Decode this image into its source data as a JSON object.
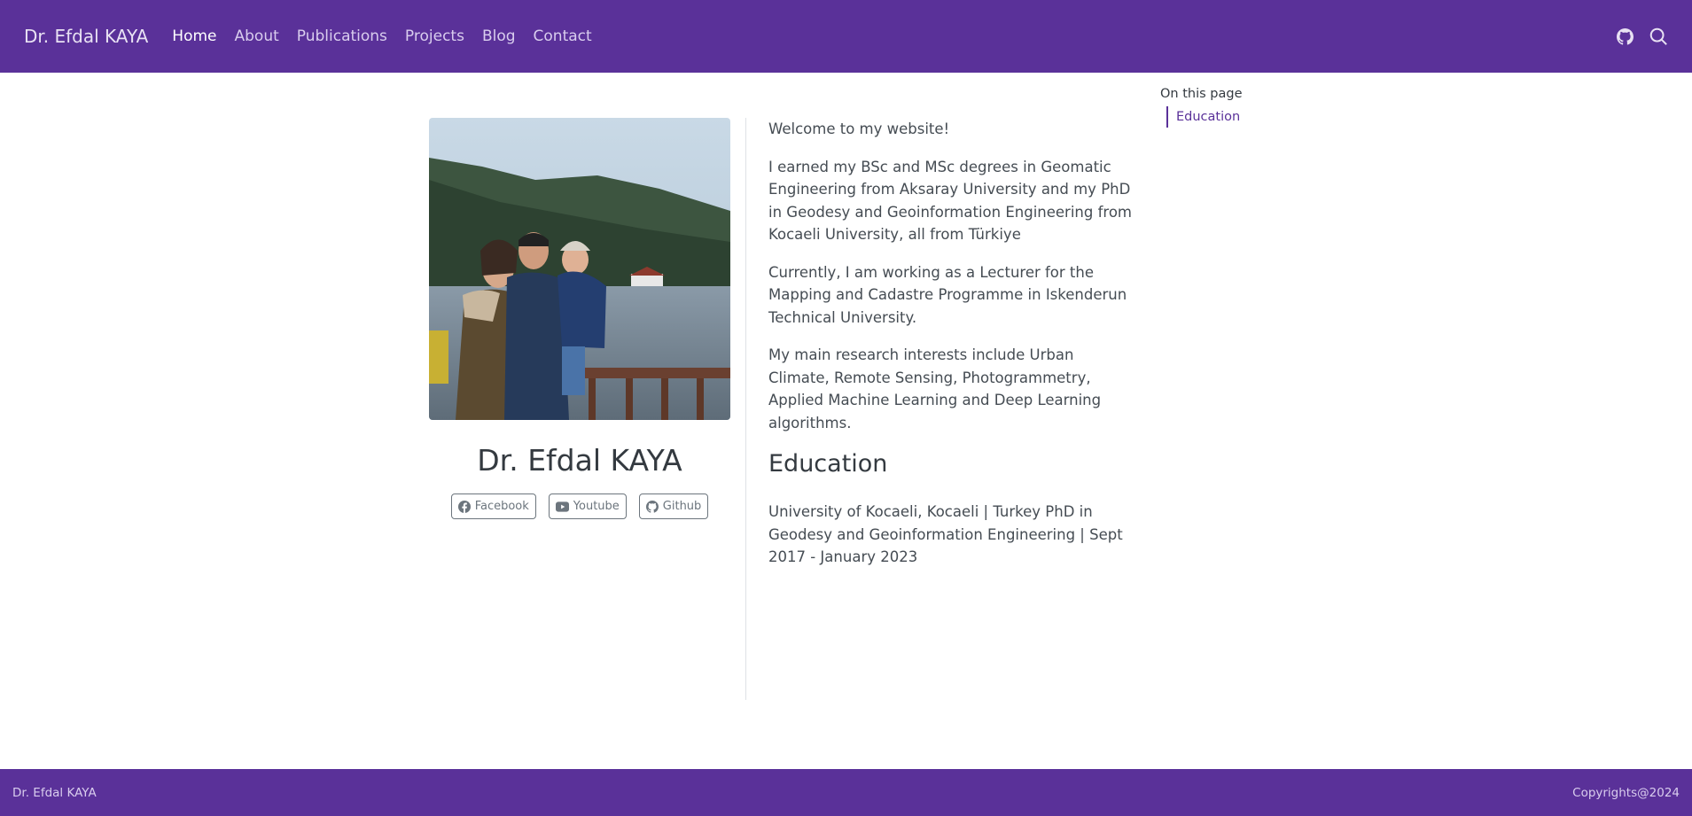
{
  "navbar": {
    "brand": "Dr. Efdal KAYA",
    "links": [
      {
        "label": "Home",
        "active": true
      },
      {
        "label": "About"
      },
      {
        "label": "Publications"
      },
      {
        "label": "Projects"
      },
      {
        "label": "Blog"
      },
      {
        "label": "Contact"
      }
    ],
    "icons": [
      "github-icon",
      "search-icon"
    ],
    "bg_color": "#5a3199"
  },
  "profile": {
    "name": "Dr. Efdal KAYA",
    "links": [
      {
        "label": "Facebook",
        "icon": "facebook-icon"
      },
      {
        "label": "Youtube",
        "icon": "youtube-icon"
      },
      {
        "label": "Github",
        "icon": "github-icon"
      }
    ]
  },
  "content": {
    "paragraphs": [
      "Welcome to my website!",
      "I earned my BSc and MSc degrees in Geomatic Engineering from Aksaray University and my PhD in Geodesy and Geoinformation Engineering from Kocaeli University, all from Türkiye",
      "Currently, I am working as a Lecturer for the Mapping and Cadastre Programme in Iskenderun Technical University.",
      "My main research interests include Urban Climate, Remote Sensing, Photogrammetry, Applied Machine Learning and Deep Learning algorithms."
    ],
    "education_heading": "Education",
    "education_text": "University of Kocaeli, Kocaeli | Turkey PhD in Geodesy and Geoinformation Engineering | Sept 2017 - January 2023"
  },
  "toc": {
    "title": "On this page",
    "items": [
      "Education"
    ]
  },
  "footer": {
    "left": "Dr. Efdal KAYA",
    "right": "Copyrights@2024"
  }
}
